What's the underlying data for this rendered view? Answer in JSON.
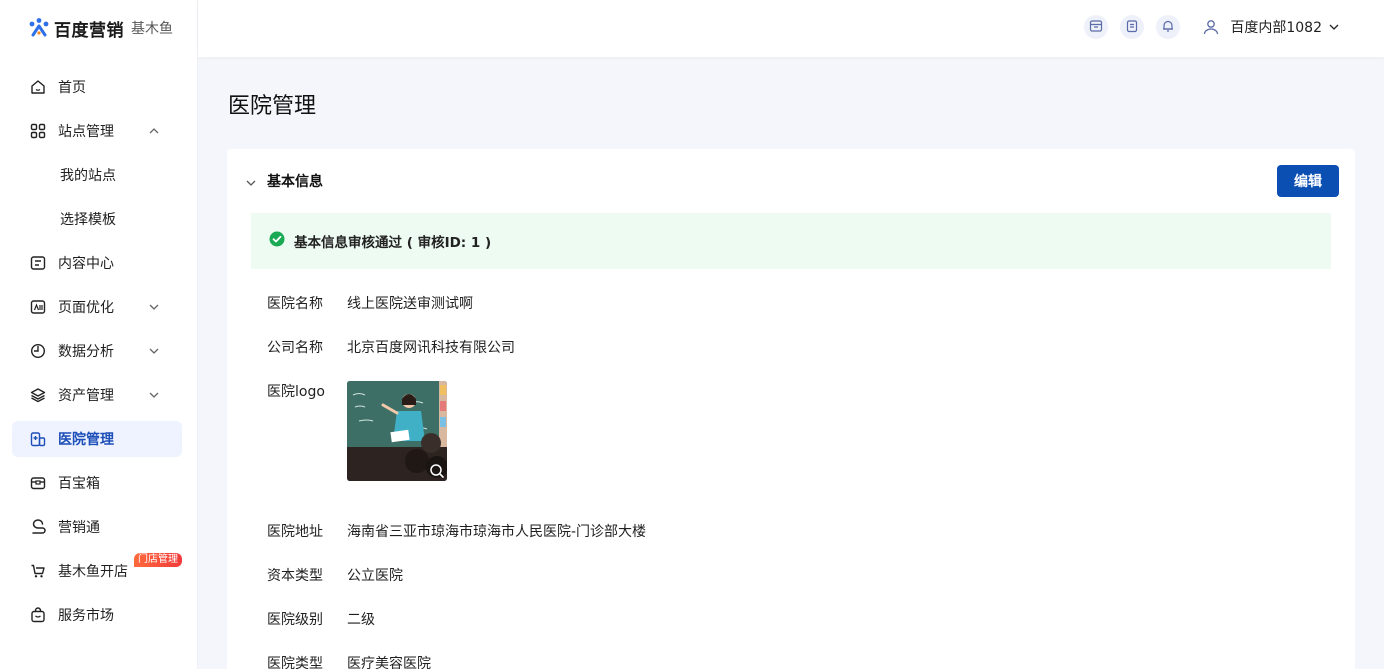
{
  "brand": {
    "name": "百度营销",
    "sub": "基木鱼"
  },
  "sidebar": {
    "items": [
      {
        "label": "首页",
        "icon": "home-icon"
      },
      {
        "label": "站点管理",
        "icon": "grid-icon",
        "expanded": true
      },
      {
        "label": "我的站点",
        "sub": true
      },
      {
        "label": "选择模板",
        "sub": true
      },
      {
        "label": "内容中心",
        "icon": "content-icon"
      },
      {
        "label": "页面优化",
        "icon": "page-optimize-icon",
        "expandable": true
      },
      {
        "label": "数据分析",
        "icon": "pie-chart-icon",
        "expandable": true
      },
      {
        "label": "资产管理",
        "icon": "layers-icon",
        "expandable": true
      },
      {
        "label": "医院管理",
        "icon": "hospital-icon",
        "active": true
      },
      {
        "label": "百宝箱",
        "icon": "toolbox-icon"
      },
      {
        "label": "营销通",
        "icon": "marketing-icon"
      },
      {
        "label": "基木鱼开店",
        "icon": "shop-cart-icon",
        "badge": "门店管理"
      },
      {
        "label": "服务市场",
        "icon": "market-bag-icon"
      }
    ]
  },
  "header": {
    "user_name": "百度内部1082"
  },
  "main": {
    "title": "医院管理",
    "section_title": "基本信息",
    "edit_label": "编辑",
    "notice": "基本信息审核通过 ( 审核ID: 1 )",
    "fields": [
      {
        "label": "医院名称",
        "value": "线上医院送审测试啊"
      },
      {
        "label": "公司名称",
        "value": "北京百度网讯科技有限公司"
      },
      {
        "label": "医院logo",
        "value": ""
      },
      {
        "label": "医院地址",
        "value": "海南省三亚市琼海市琼海市人民医院-门诊部大楼"
      },
      {
        "label": "资本类型",
        "value": "公立医院"
      },
      {
        "label": "医院级别",
        "value": "二级"
      },
      {
        "label": "医院类型",
        "value": "医疗美容医院"
      }
    ]
  },
  "colors": {
    "primary": "#0b4fb3",
    "active_bg": "#eef3ff",
    "success": "#1aaa55",
    "notice_bg": "#eefbf2"
  }
}
